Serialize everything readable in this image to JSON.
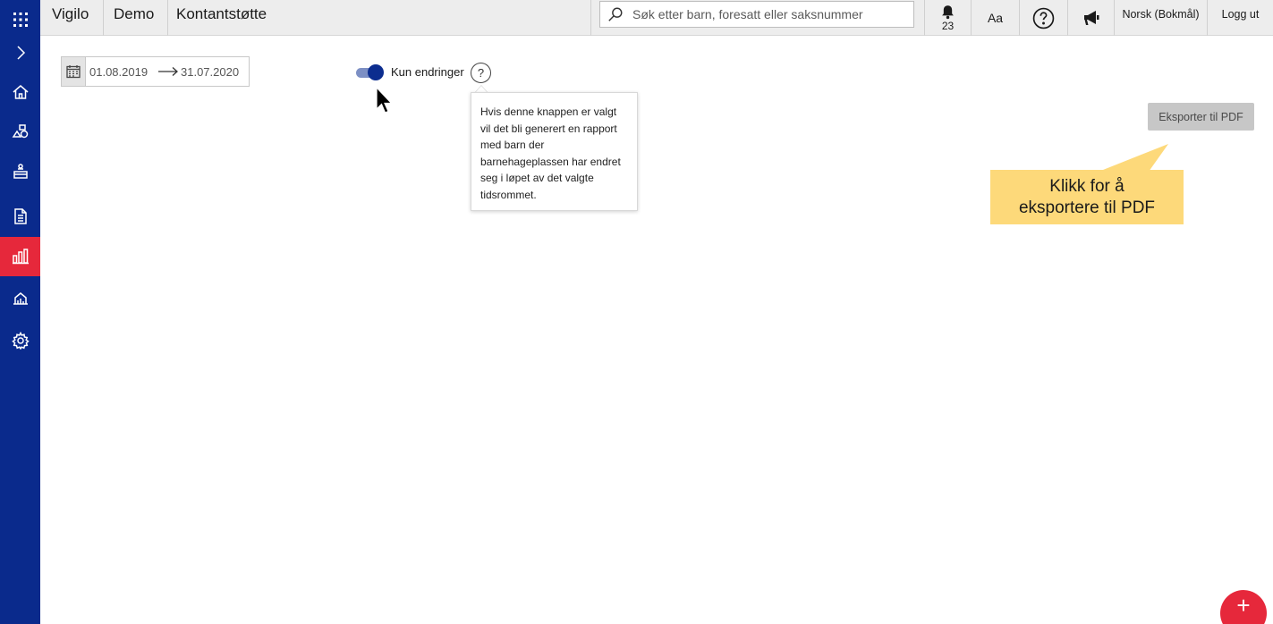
{
  "header": {
    "breadcrumbs": [
      "Vigilo",
      "Demo",
      "Kontantstøtte"
    ],
    "search_placeholder": "Søk etter barn, foresatt eller saksnummer",
    "notifications_count": "23",
    "font_size_label": "Aa",
    "help_icon": "question-circle-icon",
    "announce_icon": "megaphone-icon",
    "language_label": "Norsk (Bokmål)",
    "logout_label": "Logg ut"
  },
  "sidebar": {
    "items": [
      {
        "icon": "apps-grid-icon"
      },
      {
        "icon": "chevron-right-icon"
      },
      {
        "icon": "home-icon"
      },
      {
        "icon": "shapes-icon"
      },
      {
        "icon": "child-icon"
      },
      {
        "icon": "document-icon"
      },
      {
        "icon": "bar-chart-icon",
        "active": true
      },
      {
        "icon": "building-chart-icon"
      },
      {
        "icon": "gear-icon"
      }
    ],
    "active_color": "#e6283b",
    "background_color": "#0a2a8c"
  },
  "filters": {
    "date_from": "01.08.2019",
    "date_to": "31.07.2020",
    "toggle_label": "Kun endringer",
    "toggle_on": true,
    "help_label": "?",
    "tooltip_text": "Hvis denne knappen er valgt vil det bli generert en rapport med barn der barnehageplassen har endret seg i løpet av det valgte tidsrommet."
  },
  "actions": {
    "export_label": "Eksporter til PDF",
    "fab_label": "+"
  },
  "callout": {
    "line1": "Klikk for å",
    "line2": "eksportere til PDF",
    "color": "#fdd97a"
  }
}
